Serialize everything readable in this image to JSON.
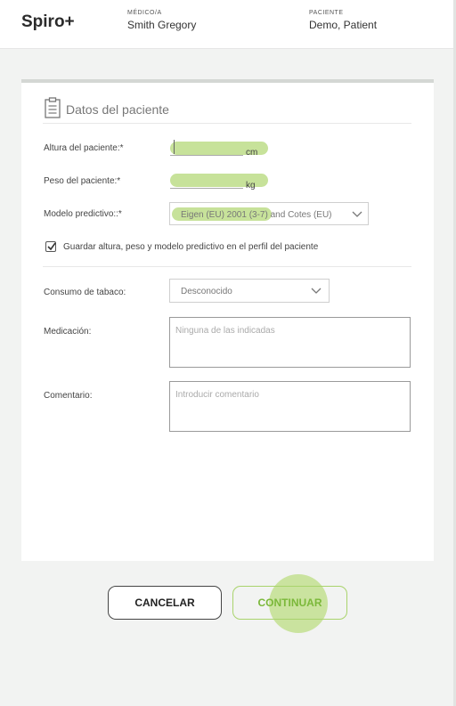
{
  "header": {
    "app_name": "Spiro+",
    "doctor_label": "MÉDICO/A",
    "doctor_name": "Smith Gregory",
    "patient_label": "PACIENTE",
    "patient_name": "Demo, Patient"
  },
  "form": {
    "section_title": "Datos del paciente",
    "height": {
      "label": "Altura del paciente:*",
      "value": "",
      "unit": "cm"
    },
    "weight": {
      "label": "Peso del paciente:*",
      "value": "",
      "unit": "kg"
    },
    "predictive_model": {
      "label": "Modelo predictivo::*",
      "selected": "Eigen (EU) 2001 (3-7) and Cotes (EU)"
    },
    "save_profile": {
      "label": "Guardar altura, peso y modelo predictivo en el perfil del paciente",
      "checked": true
    },
    "smoking": {
      "label": "Consumo de tabaco:",
      "selected": "Desconocido"
    },
    "medication": {
      "label": "Medicación:",
      "placeholder": "Ninguna de las indicadas"
    },
    "comment": {
      "label": "Comentario:",
      "placeholder": "Introducir comentario"
    }
  },
  "actions": {
    "cancel_label": "CANCELAR",
    "continue_label": "CONTINUAR"
  },
  "colors": {
    "accent": "#a9d36c",
    "highlight": "#c7e29a",
    "accent_text": "#7bb83a"
  }
}
